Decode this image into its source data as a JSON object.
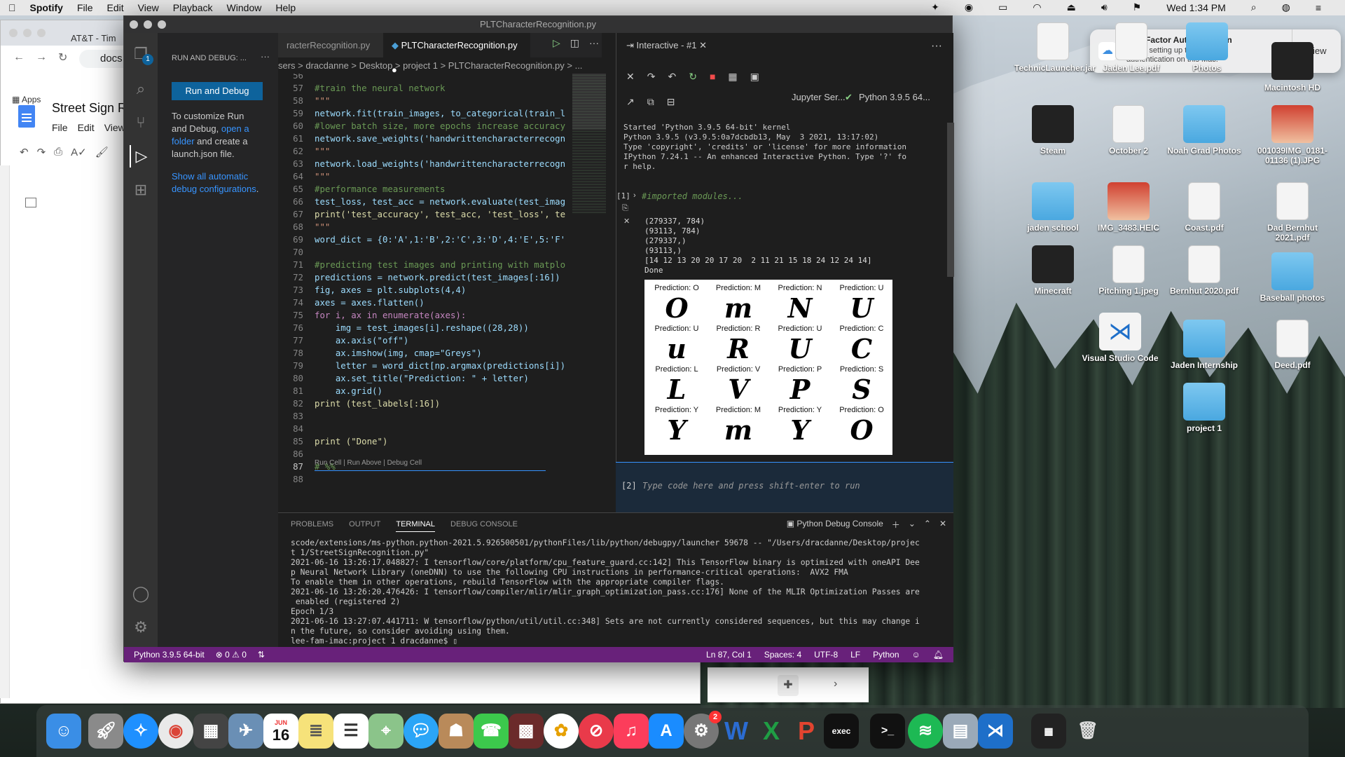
{
  "menubar": {
    "app": "Spotify",
    "items": [
      "File",
      "Edit",
      "View",
      "Playback",
      "Window",
      "Help"
    ],
    "clock": "Wed 1:34 PM"
  },
  "chrome": {
    "tab": "AT&T - Tim",
    "url": "docs.",
    "apps": "Apps",
    "doc_title": "Street Sign R",
    "doc_menu": [
      "File",
      "Edit",
      "View"
    ]
  },
  "vscode": {
    "window_title": "PLTCharacterRecognition.py",
    "sidebar": {
      "header": "RUN AND DEBUG: ...",
      "run_button": "Run and Debug",
      "text1": "To customize Run and Debug, ",
      "link_open": "open a folder",
      "text2": " and create a launch.json file.",
      "link_show": "Show all automatic debug configurations",
      "text3": "."
    },
    "tabs": [
      "racterRecognition.py",
      "PLTCharacterRecognition.py"
    ],
    "breadcrumb": "sers  >  dracdanne  >  Desktop  >  project 1  >  PLTCharacterRecognition.py  >  ...",
    "code_lines": [
      {
        "n": "56",
        "t": "",
        "c": "c-com"
      },
      {
        "n": "57",
        "t": "#train the neural network",
        "c": "c-com"
      },
      {
        "n": "58",
        "t": "\"\"\"",
        "c": "c-str"
      },
      {
        "n": "59",
        "t": "network.fit(train_images, to_categorical(train_l",
        "c": "c-var"
      },
      {
        "n": "60",
        "t": "#lower batch size, more epochs increase accuracy",
        "c": "c-com"
      },
      {
        "n": "61",
        "t": "network.save_weights('handwrittencharacterrecogn",
        "c": "c-var"
      },
      {
        "n": "62",
        "t": "\"\"\"",
        "c": "c-str"
      },
      {
        "n": "63",
        "t": "network.load_weights('handwrittencharacterrecogn",
        "c": "c-var"
      },
      {
        "n": "64",
        "t": "\"\"\"",
        "c": "c-str"
      },
      {
        "n": "65",
        "t": "#performance measurements",
        "c": "c-com"
      },
      {
        "n": "66",
        "t": "test_loss, test_acc = network.evaluate(test_imag",
        "c": "c-var"
      },
      {
        "n": "67",
        "t": "print('test_accuracy', test_acc, 'test_loss', te",
        "c": "c-fn"
      },
      {
        "n": "68",
        "t": "\"\"\"",
        "c": "c-str"
      },
      {
        "n": "69",
        "t": "word_dict = {0:'A',1:'B',2:'C',3:'D',4:'E',5:'F'",
        "c": "c-var"
      },
      {
        "n": "70",
        "t": "",
        "c": ""
      },
      {
        "n": "71",
        "t": "#predicting test images and printing with matplo",
        "c": "c-com"
      },
      {
        "n": "72",
        "t": "predictions = network.predict(test_images[:16])",
        "c": "c-var"
      },
      {
        "n": "73",
        "t": "fig, axes = plt.subplots(4,4)",
        "c": "c-var"
      },
      {
        "n": "74",
        "t": "axes = axes.flatten()",
        "c": "c-var"
      },
      {
        "n": "75",
        "t": "for i, ax in enumerate(axes):",
        "c": "c-kw"
      },
      {
        "n": "76",
        "t": "    img = test_images[i].reshape((28,28))",
        "c": "c-var"
      },
      {
        "n": "77",
        "t": "    ax.axis(\"off\")",
        "c": "c-var"
      },
      {
        "n": "78",
        "t": "    ax.imshow(img, cmap=\"Greys\")",
        "c": "c-var"
      },
      {
        "n": "79",
        "t": "    letter = word_dict[np.argmax(predictions[i])",
        "c": "c-var"
      },
      {
        "n": "80",
        "t": "    ax.set_title(\"Prediction: \" + letter)",
        "c": "c-var"
      },
      {
        "n": "81",
        "t": "    ax.grid()",
        "c": "c-var"
      },
      {
        "n": "82",
        "t": "print (test_labels[:16])",
        "c": "c-fn"
      },
      {
        "n": "83",
        "t": "",
        "c": ""
      },
      {
        "n": "84",
        "t": "",
        "c": ""
      },
      {
        "n": "85",
        "t": "print (\"Done\")",
        "c": "c-fn"
      },
      {
        "n": "86",
        "t": "",
        "c": ""
      },
      {
        "n": "87",
        "t": "# %%",
        "c": "c-com"
      },
      {
        "n": "88",
        "t": "",
        "c": ""
      }
    ],
    "codelens": "Run Cell | Run Above | Debug Cell",
    "interactive": {
      "tab": "Interactive - #1",
      "jupyter": "Jupyter Ser...",
      "kernel": "Python 3.9.5 64...",
      "startup": "Started 'Python 3.9.5 64-bit' kernel\nPython 3.9.5 (v3.9.5:0a7dcbdb13, May  3 2021, 13:17:02)\nType 'copyright', 'credits' or 'license' for more information\nIPython 7.24.1 -- An enhanced Interactive Python. Type '?' fo\nr help.",
      "cell1_label": "[1]",
      "cell1_code": "#imported modules...",
      "cell1_output": "(279337, 784)\n(93113, 784)\n(279337,)\n(93113,)\n[14 12 13 20 20 17 20  2 11 21 15 18 24 12 24 14]\nDone",
      "predictions": [
        {
          "title": "Prediction: O",
          "glyph": "O"
        },
        {
          "title": "Prediction: M",
          "glyph": "m"
        },
        {
          "title": "Prediction: N",
          "glyph": "N"
        },
        {
          "title": "Prediction: U",
          "glyph": "U"
        },
        {
          "title": "Prediction: U",
          "glyph": "u"
        },
        {
          "title": "Prediction: R",
          "glyph": "R"
        },
        {
          "title": "Prediction: U",
          "glyph": "U"
        },
        {
          "title": "Prediction: C",
          "glyph": "C"
        },
        {
          "title": "Prediction: L",
          "glyph": "L"
        },
        {
          "title": "Prediction: V",
          "glyph": "V"
        },
        {
          "title": "Prediction: P",
          "glyph": "P"
        },
        {
          "title": "Prediction: S",
          "glyph": "S"
        },
        {
          "title": "Prediction: Y",
          "glyph": "Y"
        },
        {
          "title": "Prediction: M",
          "glyph": "m"
        },
        {
          "title": "Prediction: Y",
          "glyph": "Y"
        },
        {
          "title": "Prediction: O",
          "glyph": "O"
        }
      ],
      "input_label": "[2]",
      "input_placeholder": "Type code here and press shift-enter to run"
    },
    "panel": {
      "tabs": [
        "PROBLEMS",
        "OUTPUT",
        "TERMINAL",
        "DEBUG CONSOLE"
      ],
      "console": "Python Debug Console",
      "terminal": "scode/extensions/ms-python.python-2021.5.926500501/pythonFiles/lib/python/debugpy/launcher 59678 -- \"/Users/dracdanne/Desktop/projec\nt 1/StreetSignRecognition.py\"\n2021-06-16 13:26:17.048827: I tensorflow/core/platform/cpu_feature_guard.cc:142] This TensorFlow binary is optimized with oneAPI Dee\np Neural Network Library (oneDNN) to use the following CPU instructions in performance-critical operations:  AVX2 FMA\nTo enable them in other operations, rebuild TensorFlow with the appropriate compiler flags.\n2021-06-16 13:26:20.476426: I tensorflow/compiler/mlir/mlir_graph_optimization_pass.cc:176] None of the MLIR Optimization Passes are\n enabled (registered 2)\nEpoch 1/3\n2021-06-16 13:27:07.441711: W tensorflow/python/util/util.cc:348] Sets are not currently considered sequences, but this may change i\nn the future, so consider avoiding using them.\nlee-fam-imac:project 1 dracdanne$ ▯"
    },
    "status": {
      "interpreter": "Python 3.9.5 64-bit",
      "problems": "⊗ 0 ⚠ 0",
      "position": "Ln 87, Col 1",
      "spaces": "Spaces: 4",
      "encoding": "UTF-8",
      "eol": "LF",
      "language": "Python"
    },
    "status_color": "#68217a"
  },
  "notification": {
    "title": "Two-Factor Authentication",
    "body": "Finish setting up two-factor authentication on this Mac.",
    "action": "View"
  },
  "desktop_icons": [
    {
      "label": "TechnicLauncher.jar",
      "kind": "doc"
    },
    {
      "label": "Jaden Lee.pdf",
      "kind": "doc"
    },
    {
      "label": "Photos",
      "kind": "folder"
    },
    {
      "label": "Macintosh HD",
      "kind": "dark"
    },
    {
      "label": "Steam",
      "kind": "dark"
    },
    {
      "label": "October 2",
      "kind": "doc"
    },
    {
      "label": "Noah Grad Photos",
      "kind": "folder"
    },
    {
      "label": "001039IMG_0181-01136 (1).JPG",
      "kind": "photo"
    },
    {
      "label": "jaden school",
      "kind": "folder"
    },
    {
      "label": "IMG_3483.HEIC",
      "kind": "photo"
    },
    {
      "label": "Coast.pdf",
      "kind": "doc"
    },
    {
      "label": "Dad Bernhut 2021.pdf",
      "kind": "doc"
    },
    {
      "label": "Minecraft",
      "kind": "dark"
    },
    {
      "label": "Pitching 1.jpeg",
      "kind": "doc"
    },
    {
      "label": "Bernhut 2020.pdf",
      "kind": "doc"
    },
    {
      "label": "Baseball photos",
      "kind": "folder"
    },
    {
      "label": "Visual Studio Code",
      "kind": "app"
    },
    {
      "label": "Jaden Internship",
      "kind": "folder"
    },
    {
      "label": "Deed.pdf",
      "kind": "doc"
    },
    {
      "label": "project 1",
      "kind": "folder"
    }
  ],
  "dock": {
    "calendar_day": "16",
    "calendar_month": "JUN",
    "settings_badge": "2"
  }
}
